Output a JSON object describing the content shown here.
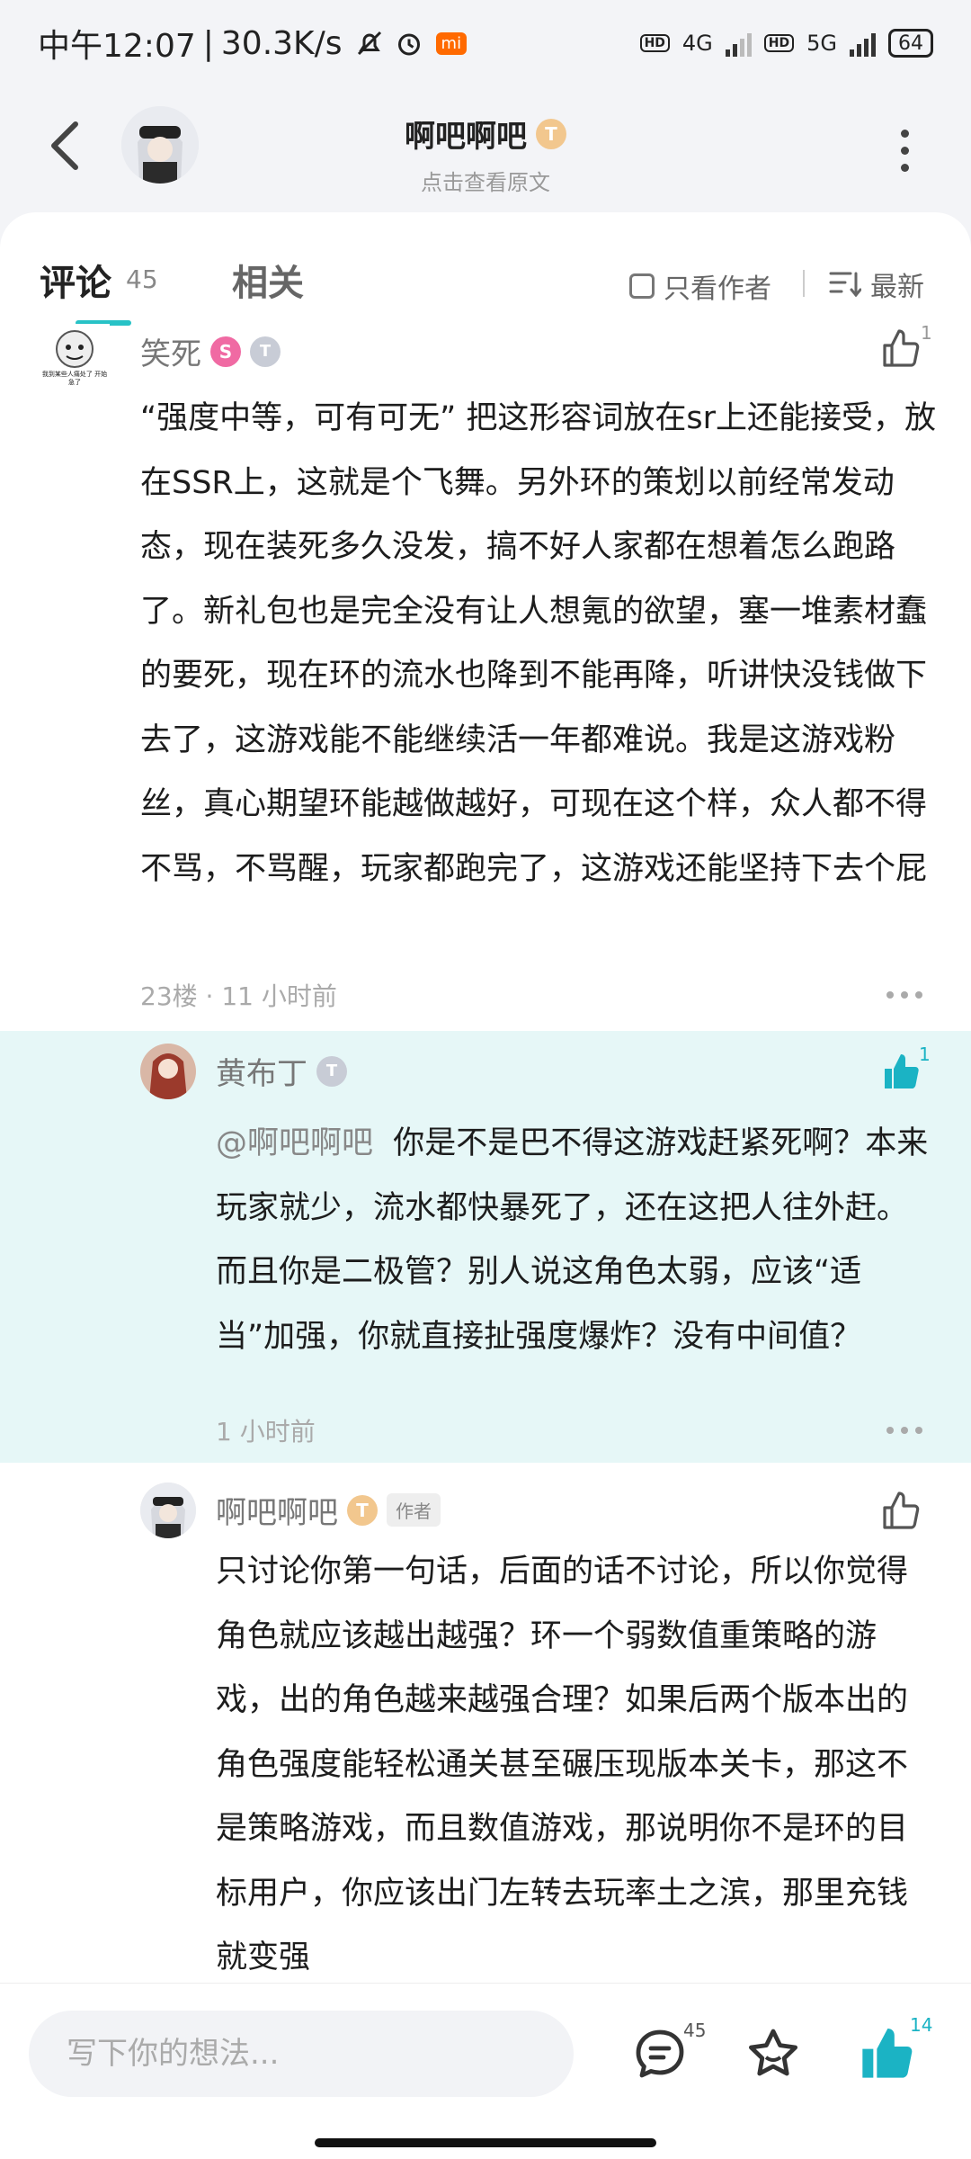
{
  "status_bar": {
    "time": "中午12:07",
    "speed": "30.3K/s",
    "mi_badge": "mi",
    "net1": "4G",
    "net2": "5G",
    "hd": "HD",
    "battery": "64"
  },
  "header": {
    "title": "啊吧啊吧",
    "subtitle": "点击查看原文",
    "badge": "T"
  },
  "tabs": {
    "comments_label": "评论",
    "comments_count": "45",
    "related_label": "相关",
    "only_author_label": "只看作者",
    "sort_label": "最新"
  },
  "comments": [
    {
      "name": "笑死",
      "badge1": "S",
      "badge2": "T",
      "avatar_text": "我到某些人痛处了 开始急了",
      "body": "“强度中等，可有可无” 把这形容词放在sr上还能接受，放在SSR上，这就是个飞舞。另外环的策划以前经常发动态，现在装死多久没发，搞不好人家都在想着怎么跑路了。新礼包也是完全没有让人想氪的欲望，塞一堆素材蠢的要死，现在环的流水也降到不能再降，听讲快没钱做下去了，这游戏能不能继续活一年都难说。我是这游戏粉丝，真心期望环能越做越好，可现在这个样，众人都不得不骂，不骂醒，玩家都跑完了，这游戏还能坚持下去个屁",
      "meta": "23楼 · 11 小时前",
      "likes": "1"
    },
    {
      "name": "黄布丁",
      "badge": "T",
      "mention": "@啊吧啊吧",
      "body": "你是不是巴不得这游戏赶紧死啊？本来玩家就少，流水都快暴死了，还在这把人往外赶。而且你是二极管？别人说这角色太弱，应该“适当”加强，你就直接扯强度爆炸？没有中间值？",
      "meta": "1 小时前",
      "likes": "1"
    },
    {
      "name": "啊吧啊吧",
      "badge": "T",
      "author_tag": "作者",
      "body": "只讨论你第一句话，后面的话不讨论，所以你觉得角色就应该越出越强？环一个弱数值重策略的游戏，出的角色越来越强合理？如果后两个版本出的角色强度能轻松通关甚至碾压现版本关卡，那这不是策略游戏，而且数值游戏，那说明你不是环的目标用户，你应该出门左转去玩率土之滨，那里充钱就变强"
    }
  ],
  "bottom_bar": {
    "input_placeholder": "写下你的想法...",
    "comment_count": "45",
    "like_count": "14"
  },
  "colors": {
    "accent": "#27c2c6",
    "reply_bg": "#e6f7f7",
    "like_active": "#1bb3c4"
  }
}
